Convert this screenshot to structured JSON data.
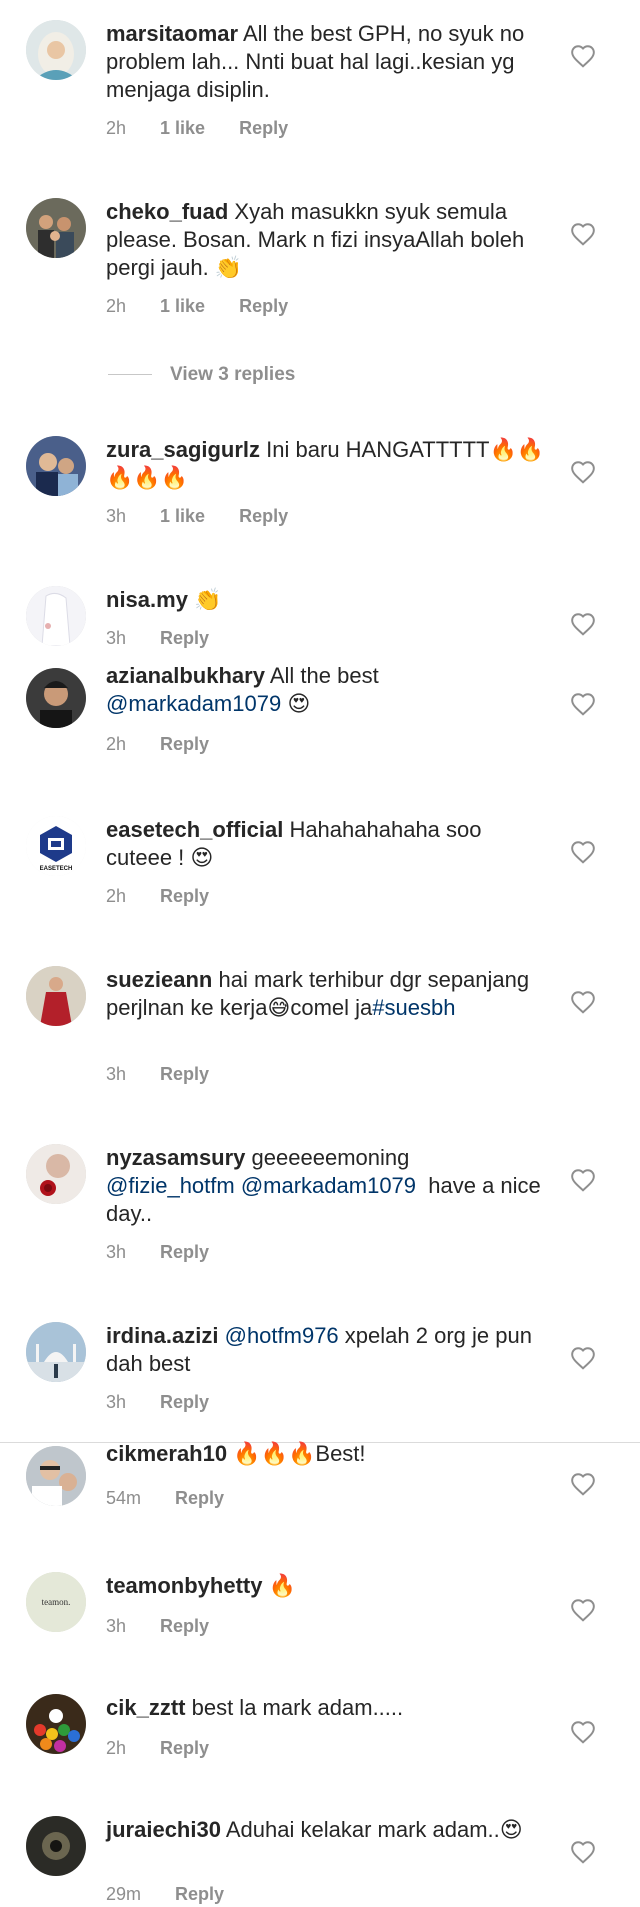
{
  "comments": [
    {
      "user": "marsitaomar",
      "text": "All the best GPH, no syuk no problem lah... Nnti buat hal lagi..kesian yg menjaga disiplin.",
      "time": "2h",
      "likes": "1 like",
      "reply": "Reply",
      "avatar": "hijab-woman-avatar"
    },
    {
      "user": "cheko_fuad",
      "text": "Xyah masukkn syuk semula please. Bosan. Mark n fizi insyaAllah boleh pergi jauh. 👏",
      "time": "2h",
      "likes": "1 like",
      "reply": "Reply",
      "avatar": "family-avatar"
    },
    {
      "user": "zura_sagigurlz",
      "text": "Ini baru HANGATTTTT🔥🔥🔥🔥🔥",
      "time": "3h",
      "likes": "1 like",
      "reply": "Reply",
      "avatar": "couple-avatar"
    },
    {
      "user": "nisa.my",
      "text": "👏",
      "time": "3h",
      "reply": "Reply",
      "avatar": "white-dress-avatar"
    },
    {
      "user": "azianalbukhary",
      "text": "All the best",
      "mention": "@markadam1079",
      "tail": " 😍",
      "time": "2h",
      "reply": "Reply",
      "avatar": "man-avatar"
    },
    {
      "user": "easetech_official",
      "text": "Hahahahahaha soo cuteee ! 😍",
      "time": "2h",
      "reply": "Reply",
      "avatar": "easetech-logo",
      "logo_text": "EASETECH"
    },
    {
      "user": "suezieann",
      "text": "hai mark terhibur dgr sepanjang perjlnan ke kerja😅comel ja",
      "mention": "#suesbh",
      "time": "3h",
      "reply": "Reply",
      "avatar": "red-dress-avatar"
    },
    {
      "user": "nyzasamsury",
      "text": "geeeeeemoning",
      "mention": "@fizie_hotfm @markadam1079",
      "tail": "  have a nice day..",
      "time": "3h",
      "reply": "Reply",
      "avatar": "rose-avatar"
    },
    {
      "user": "irdina.azizi",
      "pre_mention": "@hotfm976",
      "text": "xpelah 2 org je pun dah best",
      "time": "3h",
      "reply": "Reply",
      "avatar": "mosque-avatar"
    },
    {
      "user": "cikmerah10",
      "text": "🔥🔥🔥Best!",
      "time": "54m",
      "reply": "Reply",
      "avatar": "selfie-avatar"
    },
    {
      "user": "teamonbyhetty",
      "text": "🔥",
      "time": "3h",
      "reply": "Reply",
      "avatar": "teamon-logo",
      "logo_text": "teamon."
    },
    {
      "user": "cik_zztt",
      "text": "best la mark adam.....",
      "time": "2h",
      "reply": "Reply",
      "avatar": "colorful-balls-avatar"
    },
    {
      "user": "juraiechi30",
      "text": "Aduhai kelakar mark adam..😍",
      "time": "29m",
      "reply": "Reply",
      "avatar": "dark-avatar"
    }
  ],
  "view_replies": "View 3 replies",
  "colors": {
    "text": "#262626",
    "meta": "#8e8e8e",
    "mention": "#003569",
    "heart": "#8e8e8e"
  }
}
